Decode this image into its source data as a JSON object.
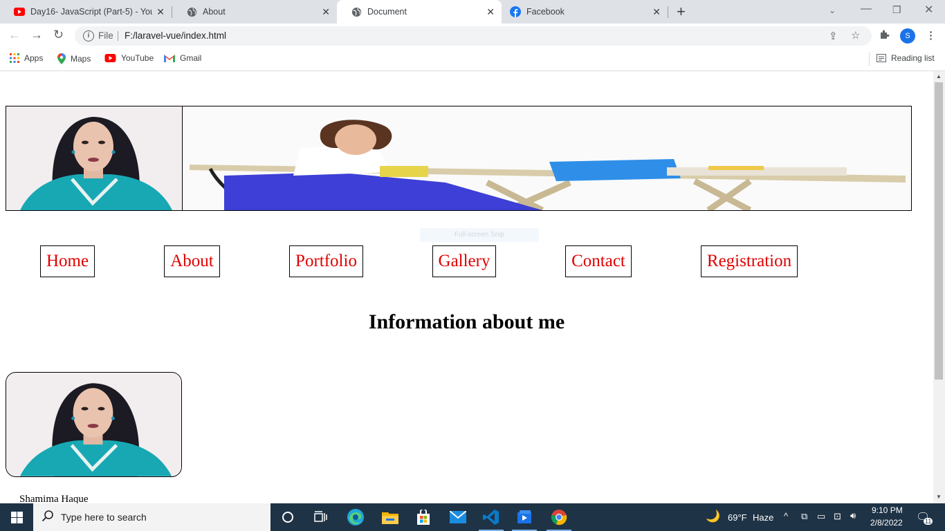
{
  "browser": {
    "tabs": [
      {
        "title": "Day16- JavaScript (Part-5) - YouT",
        "icon": "youtube-icon",
        "active": false
      },
      {
        "title": "About",
        "icon": "globe-icon",
        "active": false
      },
      {
        "title": "Document",
        "icon": "globe-icon",
        "active": true
      },
      {
        "title": "Facebook",
        "icon": "facebook-icon",
        "active": false
      }
    ],
    "omnibox": {
      "scheme_label": "File",
      "url": "F:/laravel-vue/index.html"
    },
    "profile_initial": "S",
    "bookmarks": [
      {
        "label": "Apps",
        "icon": "apps-grid-icon"
      },
      {
        "label": "Maps",
        "icon": "maps-pin-icon"
      },
      {
        "label": "YouTube",
        "icon": "youtube-icon"
      },
      {
        "label": "Gmail",
        "icon": "gmail-icon"
      }
    ],
    "reading_list_label": "Reading list"
  },
  "page": {
    "nav": [
      "Home",
      "About",
      "Portfolio",
      "Gallery",
      "Contact",
      "Registration"
    ],
    "heading": "Information about me",
    "name": "Shamima Haque",
    "snip_overlay": "Full-screen Snip",
    "link_color": "#e00000"
  },
  "taskbar": {
    "search_placeholder": "Type here to search",
    "weather": {
      "temp": "69°F",
      "condition": "Haze"
    },
    "time": "9:10 PM",
    "date": "2/8/2022",
    "notification_count": "11"
  }
}
